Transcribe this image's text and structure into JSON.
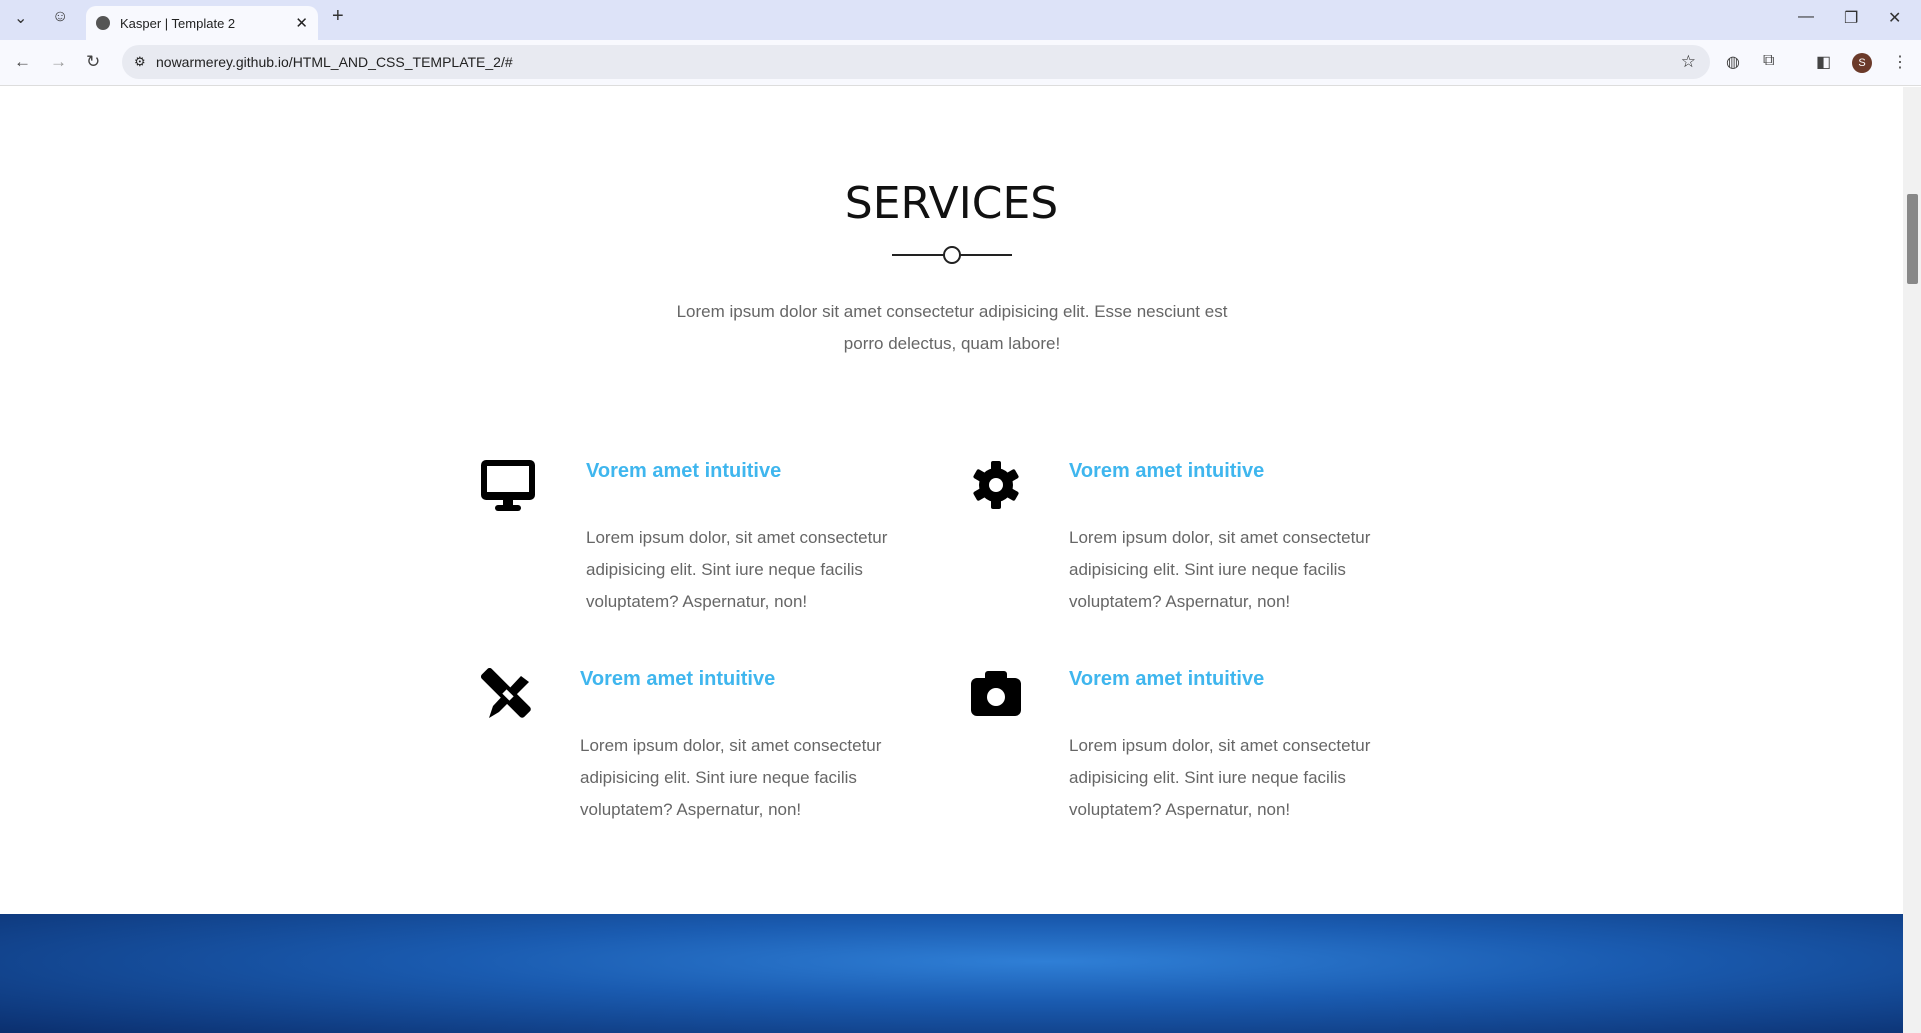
{
  "browser": {
    "tab_title": "Kasper | Template 2",
    "url": "nowarmerey.github.io/HTML_AND_CSS_TEMPLATE_2/#",
    "profile_initial": "S"
  },
  "services": {
    "title": "SERVICES",
    "intro": "Lorem ipsum dolor sit amet consectetur adipisicing elit. Esse nesciunt est porro delectus, quam labore!",
    "items": [
      {
        "icon": "desktop-icon",
        "title": "Vorem amet intuitive",
        "text": "Lorem ipsum dolor, sit amet consectetur adipisicing elit. Sint iure neque facilis voluptatem? Aspernatur, non!"
      },
      {
        "icon": "gear-icon",
        "title": "Vorem amet intuitive",
        "text": "Lorem ipsum dolor, sit amet consectetur adipisicing elit. Sint iure neque facilis voluptatem? Aspernatur, non!"
      },
      {
        "icon": "pencil-ruler-icon",
        "title": "Vorem amet intuitive",
        "text": "Lorem ipsum dolor, sit amet consectetur adipisicing elit. Sint iure neque facilis voluptatem? Aspernatur, non!"
      },
      {
        "icon": "camera-icon",
        "title": "Vorem amet intuitive",
        "text": "Lorem ipsum dolor, sit amet consectetur adipisicing elit. Sint iure neque facilis voluptatem? Aspernatur, non!"
      }
    ]
  },
  "colors": {
    "accent": "#3fb6ee"
  }
}
